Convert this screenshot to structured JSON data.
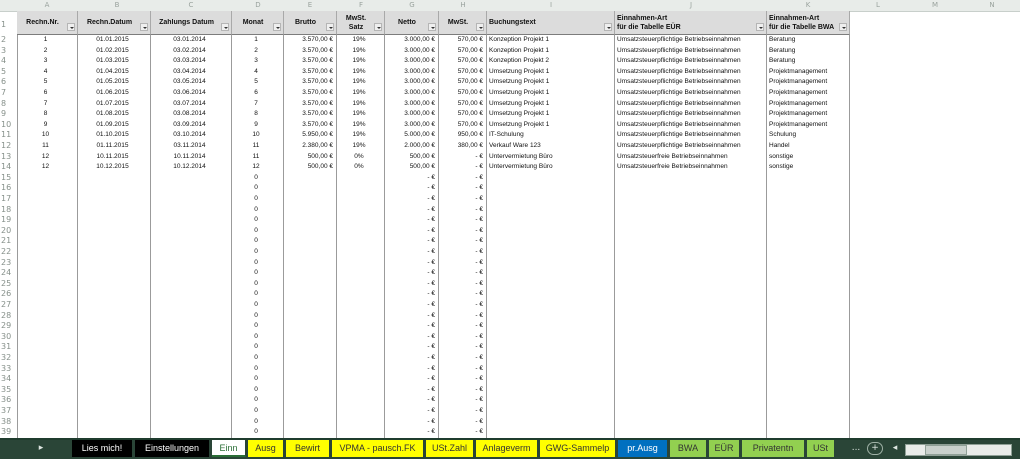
{
  "columns": [
    "A",
    "B",
    "C",
    "D",
    "E",
    "F",
    "G",
    "H",
    "I",
    "J",
    "K",
    "L",
    "M",
    "N"
  ],
  "headers": {
    "rechn_nr": "Rechn.Nr.",
    "rechn_datum": "Rechn.Datum",
    "zahlungs_datum": "Zahlungs Datum",
    "monat": "Monat",
    "brutto": "Brutto",
    "mwst_satz": "MwSt.\nSatz",
    "netto": "Netto",
    "mwst": "MwSt.",
    "buchungstext": "Buchungstext",
    "einnahmen_eur": "Einnahmen-Art\nfür die Tabelle EÜR",
    "einnahmen_bwa": "Einnahmen-Art\nfür die Tabelle BWA"
  },
  "rows": [
    {
      "nr": "1",
      "rdat": "01.01.2015",
      "zdat": "03.01.2014",
      "monat": "1",
      "brutto": "3.570,00 €",
      "satz": "19%",
      "netto": "3.000,00 €",
      "mwst": "570,00 €",
      "text": "Konzeption Projekt 1",
      "eur": "Umsatzsteuerpflichtige Betriebseinnahmen",
      "bwa": "Beratung"
    },
    {
      "nr": "2",
      "rdat": "01.02.2015",
      "zdat": "03.02.2014",
      "monat": "2",
      "brutto": "3.570,00 €",
      "satz": "19%",
      "netto": "3.000,00 €",
      "mwst": "570,00 €",
      "text": "Konzeption Projekt 1",
      "eur": "Umsatzsteuerpflichtige Betriebseinnahmen",
      "bwa": "Beratung"
    },
    {
      "nr": "3",
      "rdat": "01.03.2015",
      "zdat": "03.03.2014",
      "monat": "3",
      "brutto": "3.570,00 €",
      "satz": "19%",
      "netto": "3.000,00 €",
      "mwst": "570,00 €",
      "text": "Konzeption Projekt 2",
      "eur": "Umsatzsteuerpflichtige Betriebseinnahmen",
      "bwa": "Beratung"
    },
    {
      "nr": "4",
      "rdat": "01.04.2015",
      "zdat": "03.04.2014",
      "monat": "4",
      "brutto": "3.570,00 €",
      "satz": "19%",
      "netto": "3.000,00 €",
      "mwst": "570,00 €",
      "text": "Umsetzung Projekt 1",
      "eur": "Umsatzsteuerpflichtige Betriebseinnahmen",
      "bwa": "Projektmanagement"
    },
    {
      "nr": "5",
      "rdat": "01.05.2015",
      "zdat": "03.05.2014",
      "monat": "5",
      "brutto": "3.570,00 €",
      "satz": "19%",
      "netto": "3.000,00 €",
      "mwst": "570,00 €",
      "text": "Umsetzung Projekt 1",
      "eur": "Umsatzsteuerpflichtige Betriebseinnahmen",
      "bwa": "Projektmanagement"
    },
    {
      "nr": "6",
      "rdat": "01.06.2015",
      "zdat": "03.06.2014",
      "monat": "6",
      "brutto": "3.570,00 €",
      "satz": "19%",
      "netto": "3.000,00 €",
      "mwst": "570,00 €",
      "text": "Umsetzung Projekt 1",
      "eur": "Umsatzsteuerpflichtige Betriebseinnahmen",
      "bwa": "Projektmanagement"
    },
    {
      "nr": "7",
      "rdat": "01.07.2015",
      "zdat": "03.07.2014",
      "monat": "7",
      "brutto": "3.570,00 €",
      "satz": "19%",
      "netto": "3.000,00 €",
      "mwst": "570,00 €",
      "text": "Umsetzung Projekt 1",
      "eur": "Umsatzsteuerpflichtige Betriebseinnahmen",
      "bwa": "Projektmanagement"
    },
    {
      "nr": "8",
      "rdat": "01.08.2015",
      "zdat": "03.08.2014",
      "monat": "8",
      "brutto": "3.570,00 €",
      "satz": "19%",
      "netto": "3.000,00 €",
      "mwst": "570,00 €",
      "text": "Umsetzung Projekt 1",
      "eur": "Umsatzsteuerpflichtige Betriebseinnahmen",
      "bwa": "Projektmanagement"
    },
    {
      "nr": "9",
      "rdat": "01.09.2015",
      "zdat": "03.09.2014",
      "monat": "9",
      "brutto": "3.570,00 €",
      "satz": "19%",
      "netto": "3.000,00 €",
      "mwst": "570,00 €",
      "text": "Umsetzung Projekt 1",
      "eur": "Umsatzsteuerpflichtige Betriebseinnahmen",
      "bwa": "Projektmanagement"
    },
    {
      "nr": "10",
      "rdat": "01.10.2015",
      "zdat": "03.10.2014",
      "monat": "10",
      "brutto": "5.950,00 €",
      "satz": "19%",
      "netto": "5.000,00 €",
      "mwst": "950,00 €",
      "text": "IT-Schulung",
      "eur": "Umsatzsteuerpflichtige Betriebseinnahmen",
      "bwa": "Schulung"
    },
    {
      "nr": "11",
      "rdat": "01.11.2015",
      "zdat": "03.11.2014",
      "monat": "11",
      "brutto": "2.380,00 €",
      "satz": "19%",
      "netto": "2.000,00 €",
      "mwst": "380,00 €",
      "text": "Verkauf Ware 123",
      "eur": "Umsatzsteuerpflichtige Betriebseinnahmen",
      "bwa": "Handel"
    },
    {
      "nr": "12",
      "rdat": "10.11.2015",
      "zdat": "10.11.2014",
      "monat": "11",
      "brutto": "500,00 €",
      "satz": "0%",
      "netto": "500,00 €",
      "mwst": "-   €",
      "text": "Untervermietung Büro",
      "eur": "Umsatzsteuerfreie Betriebseinnahmen",
      "bwa": "sonstige"
    },
    {
      "nr": "12",
      "rdat": "10.12.2015",
      "zdat": "10.12.2014",
      "monat": "12",
      "brutto": "500,00 €",
      "satz": "0%",
      "netto": "500,00 €",
      "mwst": "-   €",
      "text": "Untervermietung Büro",
      "eur": "Umsatzsteuerfreie Betriebseinnahmen",
      "bwa": "sonstige"
    }
  ],
  "empty_row": {
    "monat": "0",
    "netto": "-   €",
    "mwst": "-   €"
  },
  "row_numbers": [
    "1",
    "2",
    "3",
    "4",
    "5",
    "6",
    "7",
    "8",
    "9",
    "10",
    "11",
    "12",
    "13",
    "14",
    "15",
    "16",
    "17",
    "18",
    "19",
    "20",
    "21",
    "22",
    "23",
    "24",
    "25",
    "26",
    "27",
    "28",
    "29",
    "30",
    "31",
    "32",
    "33",
    "34",
    "35",
    "36",
    "37",
    "38",
    "39"
  ],
  "tabs": [
    {
      "label": "Lies mich!",
      "bg": "#000000",
      "fg": "#ffffff"
    },
    {
      "label": "Einstellungen",
      "bg": "#000000",
      "fg": "#ffffff"
    },
    {
      "label": "Einn",
      "bg": "#ffffff",
      "fg": "#2a6e36",
      "active": true
    },
    {
      "label": "Ausg",
      "bg": "#ffff00",
      "fg": "#333333"
    },
    {
      "label": "Bewirt",
      "bg": "#ffff00",
      "fg": "#333333"
    },
    {
      "label": "VPMA - pausch.FK",
      "bg": "#ffff00",
      "fg": "#333333"
    },
    {
      "label": "USt.Zahl",
      "bg": "#ffff00",
      "fg": "#333333"
    },
    {
      "label": "Anlageverm",
      "bg": "#ffff00",
      "fg": "#333333"
    },
    {
      "label": "GWG-Sammelp",
      "bg": "#ffff00",
      "fg": "#333333"
    },
    {
      "label": "pr.Ausg",
      "bg": "#0070c0",
      "fg": "#ffffff"
    },
    {
      "label": "BWA",
      "bg": "#92d050",
      "fg": "#333333"
    },
    {
      "label": "EÜR",
      "bg": "#92d050",
      "fg": "#333333"
    },
    {
      "label": "Privatentn",
      "bg": "#92d050",
      "fg": "#333333"
    },
    {
      "label": "USt",
      "bg": "#92d050",
      "fg": "#333333"
    }
  ],
  "tab_nav": {
    "prev": "◂",
    "next": "▸",
    "more": "...",
    "add": "+"
  }
}
